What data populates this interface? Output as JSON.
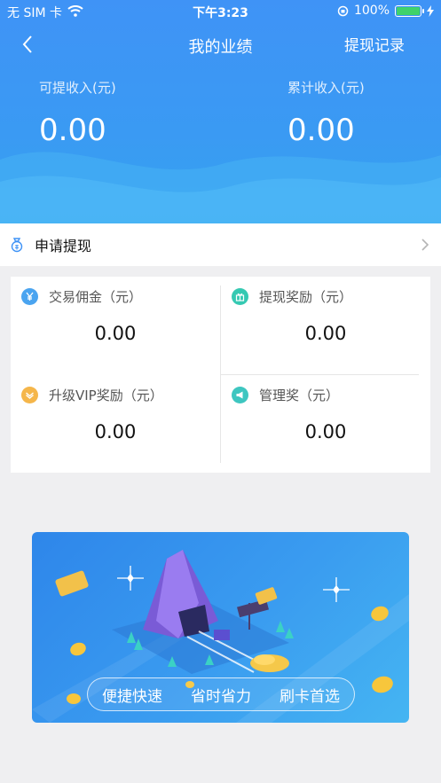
{
  "status_bar": {
    "carrier": "无 SIM 卡",
    "time": "下午3:23",
    "battery": "100%"
  },
  "nav": {
    "title": "我的业绩",
    "record_label": "提现记录"
  },
  "summary": {
    "withdrawable_label": "可提收入(元)",
    "withdrawable_value": "0.00",
    "total_label": "累计收入(元)",
    "total_value": "0.00"
  },
  "apply": {
    "label": "申请提现"
  },
  "stats": [
    {
      "label": "交易佣金（元）",
      "value": "0.00",
      "icon": "yen-icon",
      "color": "#4aa4f0"
    },
    {
      "label": "提现奖励（元）",
      "value": "0.00",
      "icon": "gift-icon",
      "color": "#35c9b2"
    },
    {
      "label": "升级VIP奖励（元）",
      "value": "0.00",
      "icon": "vip-icon",
      "color": "#f5b64a"
    },
    {
      "label": "管理奖（元）",
      "value": "0.00",
      "icon": "megaphone-icon",
      "color": "#3ec6c0"
    }
  ],
  "banner": {
    "tags": [
      "便捷快速",
      "省时省力",
      "刷卡首选"
    ]
  },
  "colors": {
    "header_blue": "#3f93f6",
    "page_bg": "#efeff1"
  }
}
